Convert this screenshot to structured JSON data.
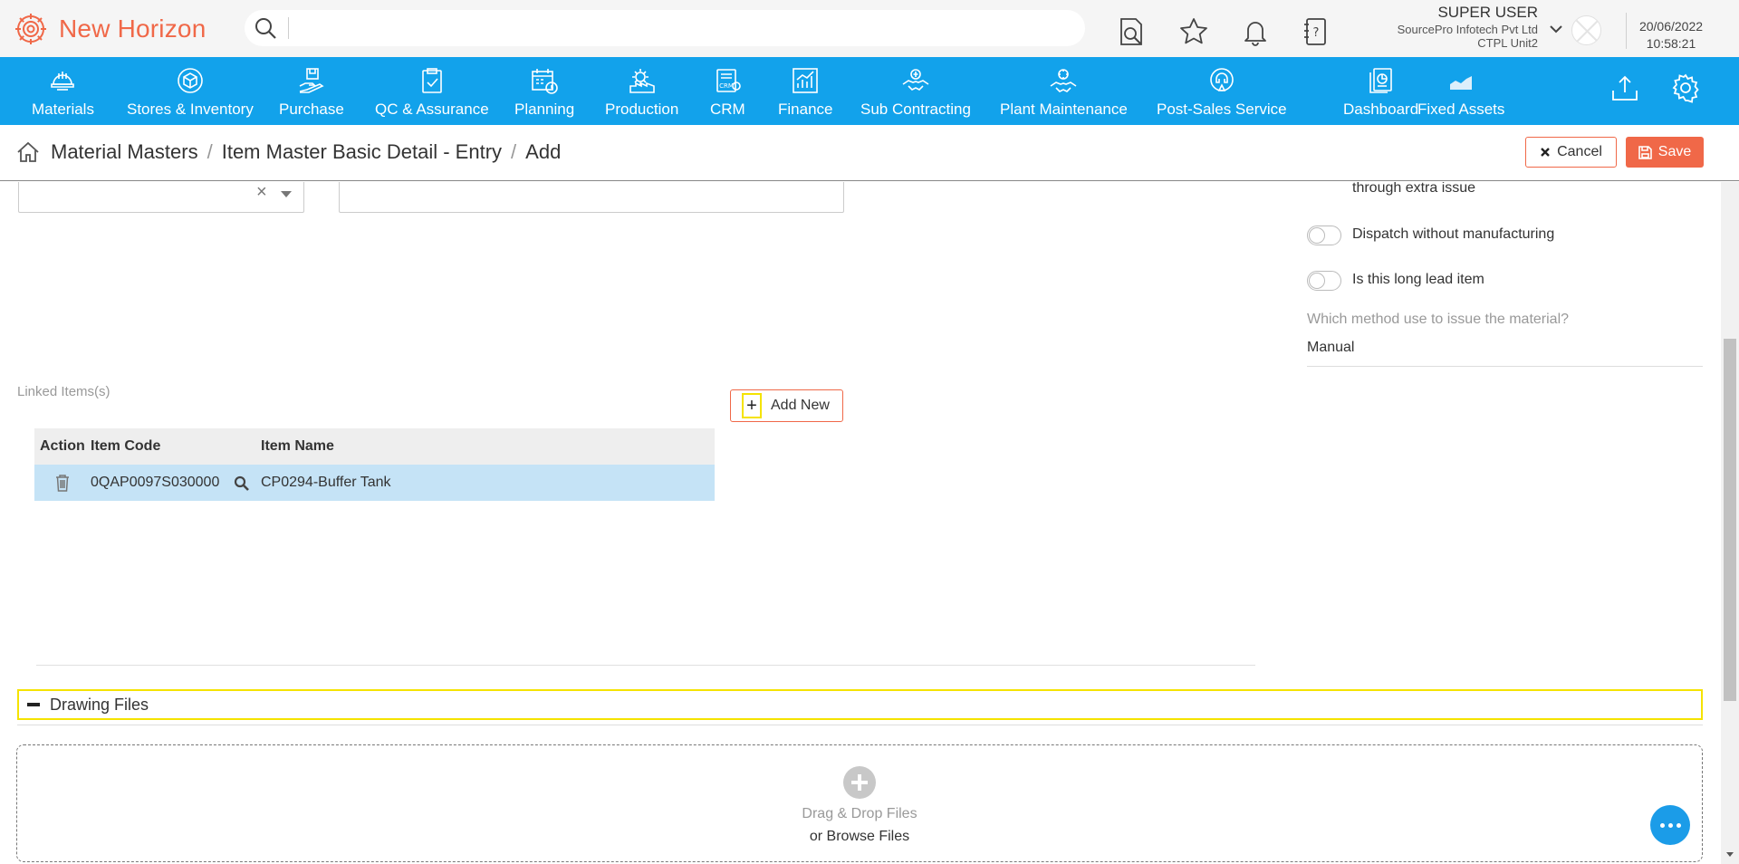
{
  "app": {
    "name": "New Horizon",
    "brand_color": "#f06848",
    "nav_color": "#12a2eb"
  },
  "search": {
    "placeholder": "",
    "value": ""
  },
  "user": {
    "name": "SUPER USER",
    "org": "SourcePro Infotech Pvt Ltd",
    "unit": "CTPL Unit2",
    "date": "20/06/2022",
    "time": "10:58:21"
  },
  "nav": {
    "items": [
      {
        "label": "Materials",
        "icon": "helmet-icon"
      },
      {
        "label": "Stores & Inventory",
        "icon": "box-icon"
      },
      {
        "label": "Purchase",
        "icon": "hand-package-icon"
      },
      {
        "label": "QC & Assurance",
        "icon": "clipboard-check-icon"
      },
      {
        "label": "Planning",
        "icon": "calendar-clock-icon"
      },
      {
        "label": "Production",
        "icon": "gear-factory-icon"
      },
      {
        "label": "CRM",
        "icon": "crm-icon"
      },
      {
        "label": "Finance",
        "icon": "chart-icon"
      },
      {
        "label": "Sub Contracting",
        "icon": "handshake-icon"
      },
      {
        "label": "Plant Maintenance",
        "icon": "maintenance-icon"
      },
      {
        "label": "Post-Sales Service",
        "icon": "service-icon"
      },
      {
        "label": "Dashboard",
        "icon": "dashboard-icon"
      },
      {
        "label": "Fixed Assets",
        "icon": "area-chart-icon"
      }
    ]
  },
  "breadcrumb": {
    "items": [
      "Material Masters",
      "Item Master Basic Detail - Entry",
      "Add"
    ],
    "separator": "/"
  },
  "actions": {
    "cancel": "Cancel",
    "save": "Save"
  },
  "form": {
    "select_clear": "×",
    "extra_issue_text": "through extra issue",
    "dispatch_label": "Dispatch without manufacturing",
    "long_lead_label": "Is this long lead item",
    "issue_method_label": "Which method use to issue the material?",
    "issue_method_value": "Manual"
  },
  "linked": {
    "label": "Linked Items(s)",
    "add_new": "Add New",
    "add_plus": "+",
    "columns": {
      "action": "Action",
      "code": "Item Code",
      "name": "Item Name"
    },
    "rows": [
      {
        "code": "0QAP0097S030000",
        "name": "CP0294-Buffer Tank"
      }
    ]
  },
  "drawing": {
    "title": "Drawing Files",
    "drop_text": "Drag & Drop Files",
    "browse_text": "or Browse Files"
  }
}
